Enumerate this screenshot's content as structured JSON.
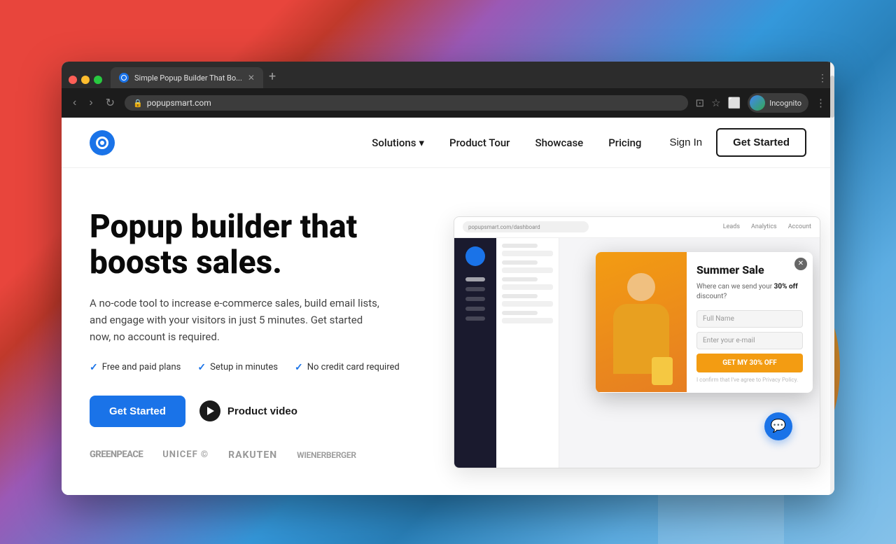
{
  "browser": {
    "tab_title": "Simple Popup Builder That Bo...",
    "url": "popupsmart.com",
    "profile_name": "Incognito"
  },
  "nav": {
    "logo_alt": "Popupsmart",
    "links": [
      {
        "label": "Solutions",
        "has_dropdown": true
      },
      {
        "label": "Product Tour",
        "has_dropdown": false
      },
      {
        "label": "Showcase",
        "has_dropdown": false
      },
      {
        "label": "Pricing",
        "has_dropdown": false
      }
    ],
    "sign_in": "Sign In",
    "get_started": "Get Started"
  },
  "hero": {
    "title": "Popup builder that boosts sales.",
    "subtitle": "A no-code tool to increase e-commerce sales, build email lists, and engage with your visitors in just 5 minutes. Get started now, no account is required.",
    "checks": [
      {
        "label": "Free and paid plans"
      },
      {
        "label": "Setup in minutes"
      },
      {
        "label": "No credit card required"
      }
    ],
    "get_started_btn": "Get Started",
    "video_btn": "Product video"
  },
  "logos": [
    {
      "label": "GREENPEACE"
    },
    {
      "label": "unicef ©"
    },
    {
      "label": "Rakuten"
    },
    {
      "label": "wienerberger"
    }
  ],
  "popup": {
    "title": "Summer Sale",
    "text_before": "Where can we send your ",
    "highlight": "30% off",
    "text_after": " discount?",
    "full_name_placeholder": "Full Name",
    "email_placeholder": "Enter your e-mail",
    "cta": "GET MY 30% OFF",
    "legal": "I confirm that I've agree to Privacy Policy."
  },
  "chat_widget_icon": "💬"
}
